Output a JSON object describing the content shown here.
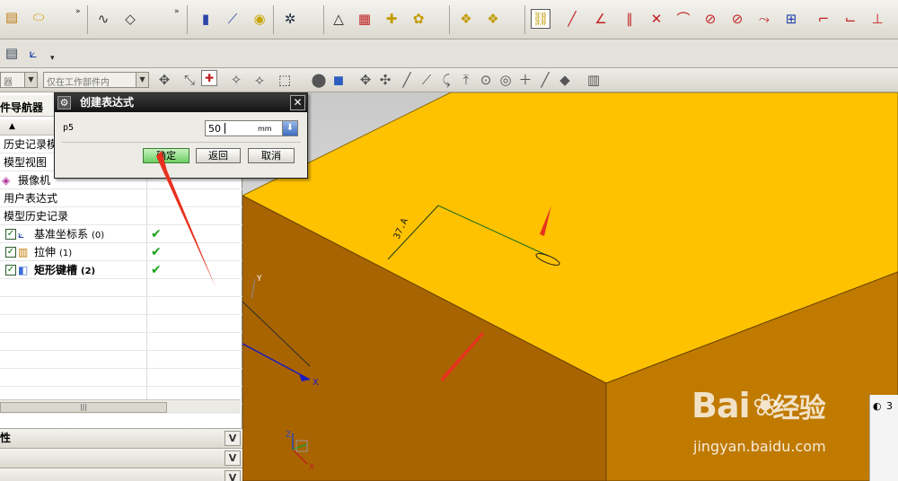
{
  "toolbar_row3": {
    "filter_combo": "器",
    "scope_combo": "仅在工作部件内"
  },
  "navigator": {
    "title": "部件导航器",
    "rows": [
      {
        "label": "历史记录模",
        "indent": 4
      },
      {
        "label": "模型视图",
        "indent": 4
      },
      {
        "label": "摄像机",
        "indent": 20
      },
      {
        "label": "用户表达式",
        "indent": 4
      },
      {
        "label": "模型历史记录",
        "indent": 4
      },
      {
        "label": "基准坐标系",
        "count": "(0)",
        "status": "✔"
      },
      {
        "label": "拉伸",
        "count": "(1)",
        "status": "✔"
      },
      {
        "label": "矩形键槽",
        "count": "(2)",
        "status": "✔"
      }
    ],
    "properties_label": "性"
  },
  "dialog": {
    "title": "创建表达式",
    "param_name": "p5",
    "value": "50",
    "unit": "mm",
    "ok_label": "确定",
    "back_label": "返回",
    "cancel_label": "取消"
  },
  "viewport": {
    "dimension_label": "37.A",
    "axis_x": "X",
    "axis_y": "Y",
    "axis_z": "Z",
    "colors": {
      "top_face": "#fec200",
      "front_face": "#a86400",
      "arrow": "#e8321e"
    }
  },
  "watermark": {
    "brand": "Bai",
    "brand_cn": "经验",
    "site": "jingyan.baidu.com"
  },
  "side_panel": {
    "label": "3"
  }
}
